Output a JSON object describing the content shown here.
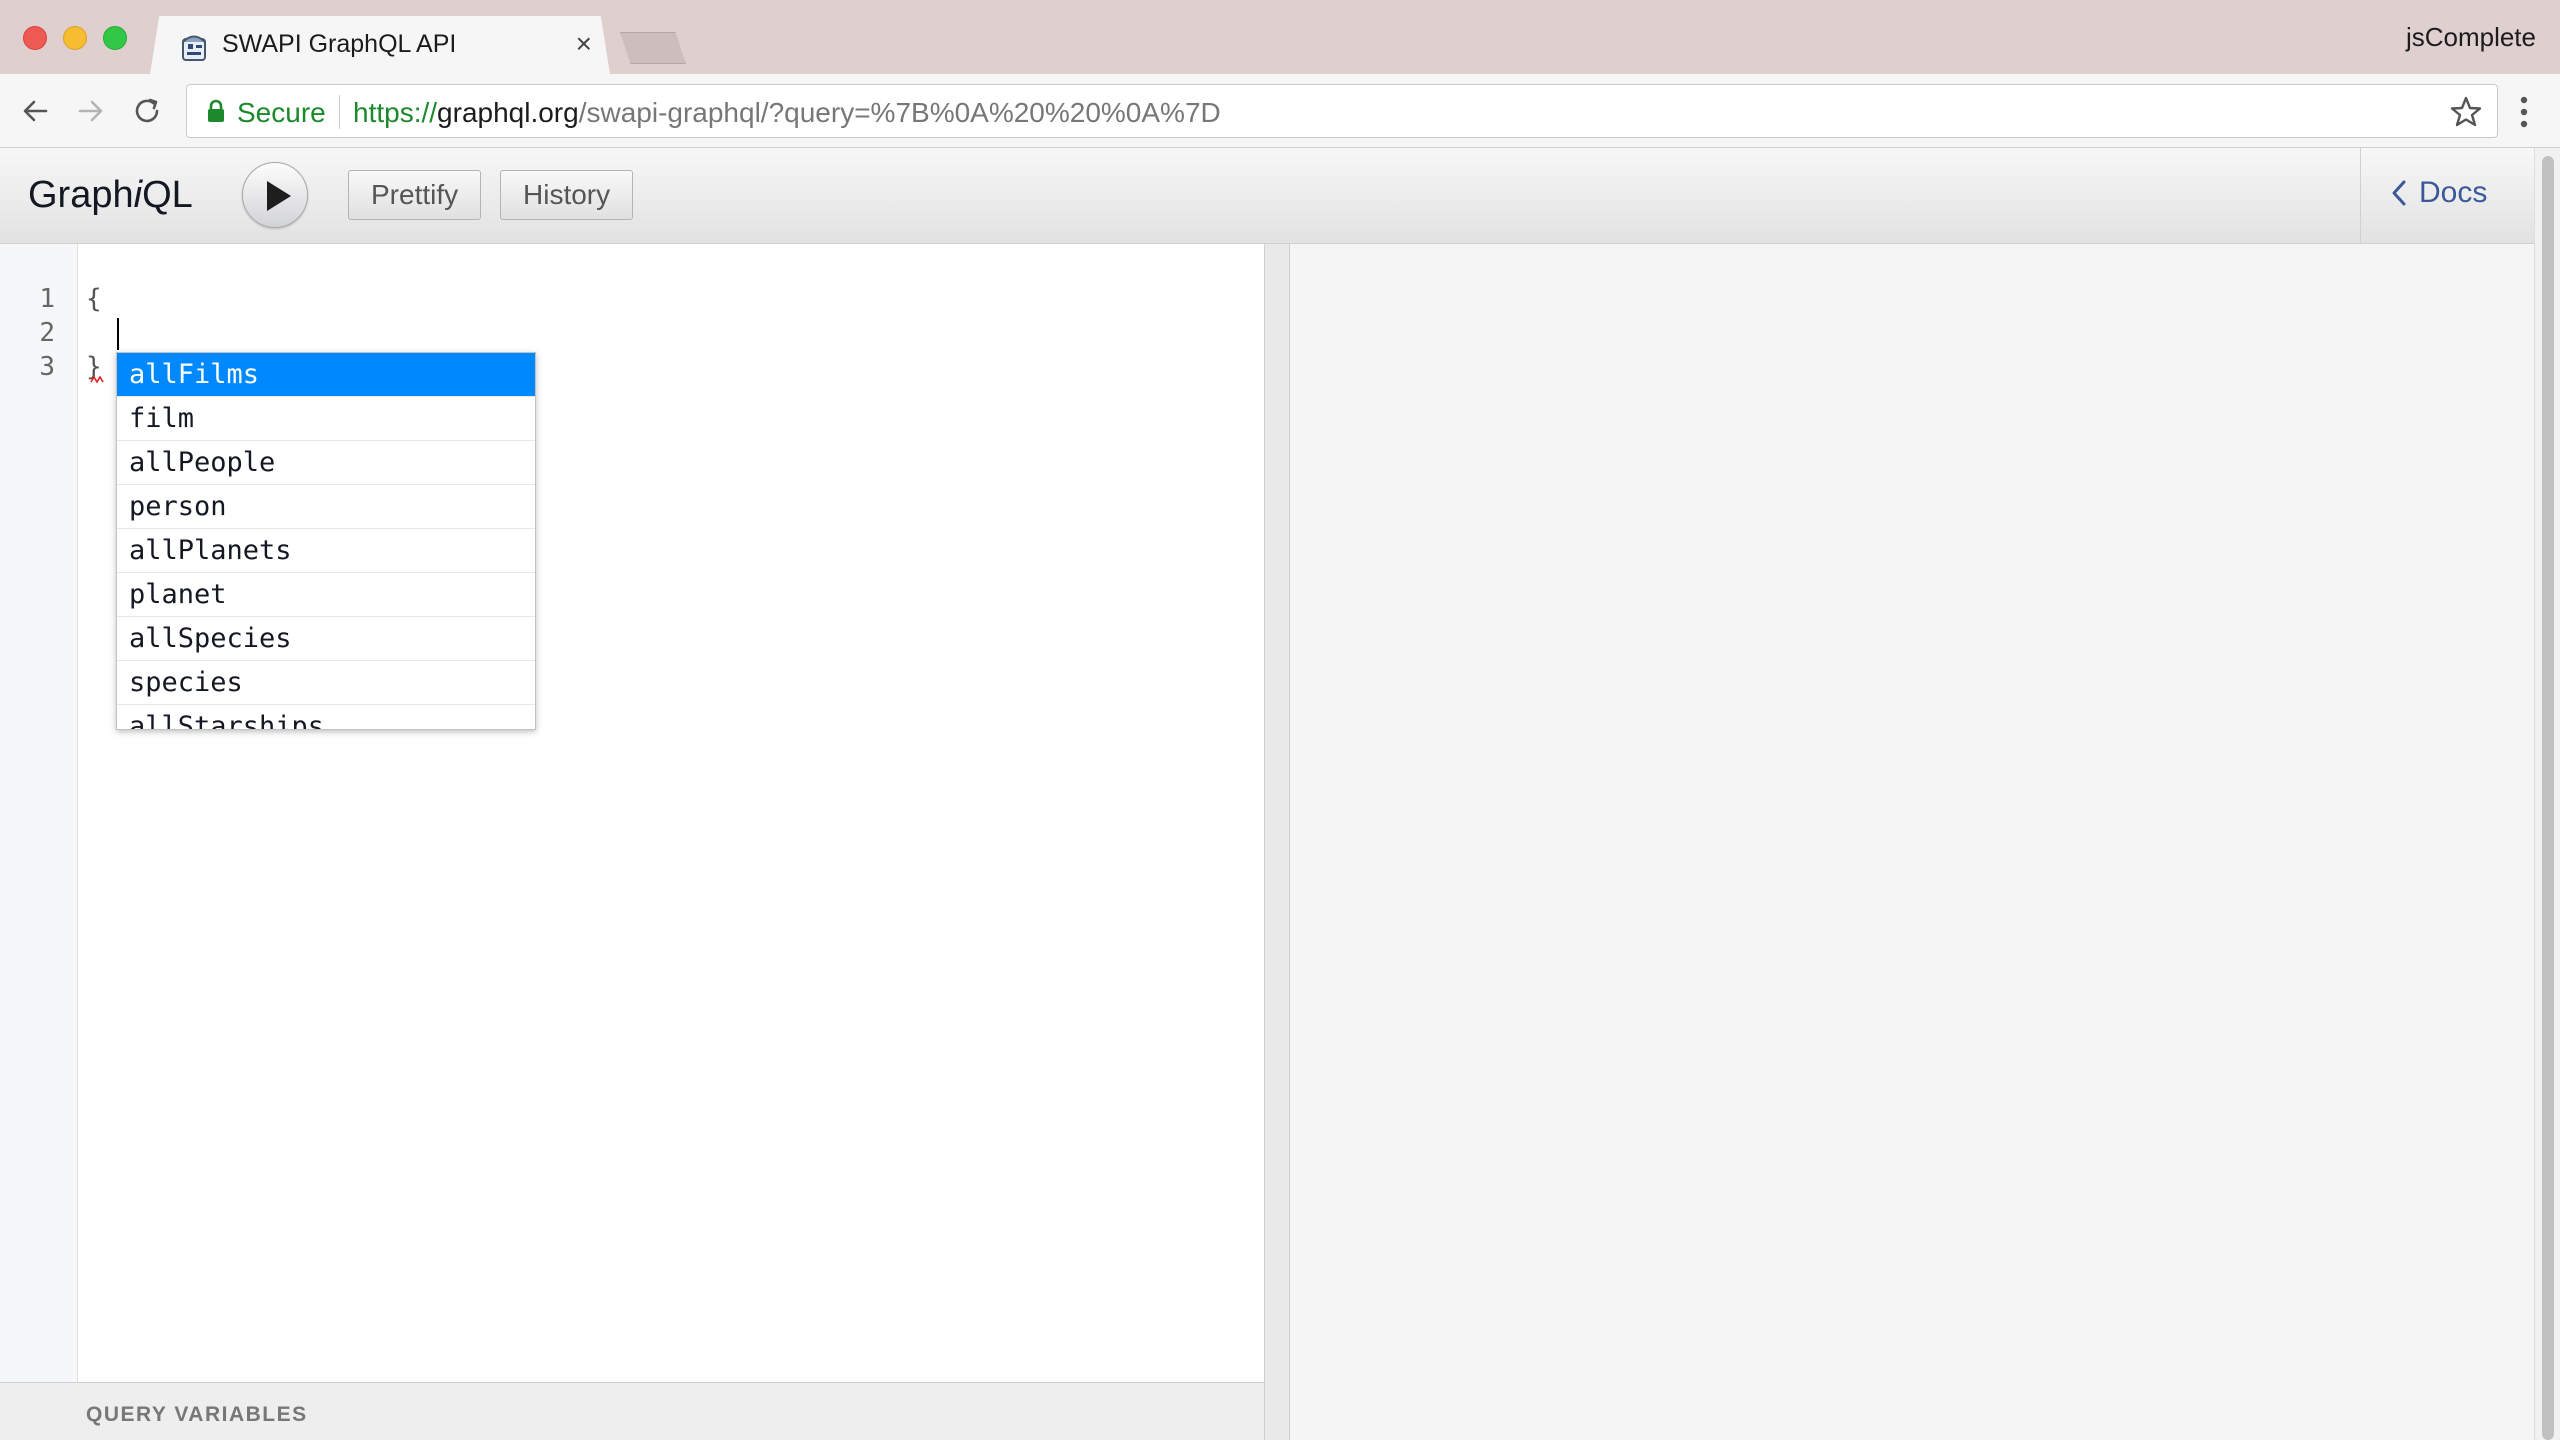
{
  "browser": {
    "tab_title": "SWAPI GraphQL API",
    "tab_close": "×",
    "profile_name": "jsComplete",
    "secure_label": "Secure",
    "url": {
      "scheme": "https://",
      "host": "graphql.org",
      "path": "/swapi-graphql/?query=%7B%0A%20%20%0A%7D"
    }
  },
  "graphiql": {
    "title_prefix": "Graph",
    "title_italic": "i",
    "title_suffix": "QL",
    "prettify_label": "Prettify",
    "history_label": "History",
    "docs_label": "Docs"
  },
  "editor": {
    "line_numbers": [
      "1",
      "2",
      "3"
    ],
    "lines": [
      "{",
      "",
      "}"
    ]
  },
  "autocomplete": {
    "items": [
      "allFilms",
      "film",
      "allPeople",
      "person",
      "allPlanets",
      "planet",
      "allSpecies",
      "species",
      "allStarships"
    ],
    "selected": "allFilms"
  },
  "query_variables": {
    "title": "QUERY VARIABLES"
  },
  "colors": {
    "accent": "#0088ff",
    "secure_green": "#1c8a2c",
    "docs_link": "#3b5998"
  }
}
